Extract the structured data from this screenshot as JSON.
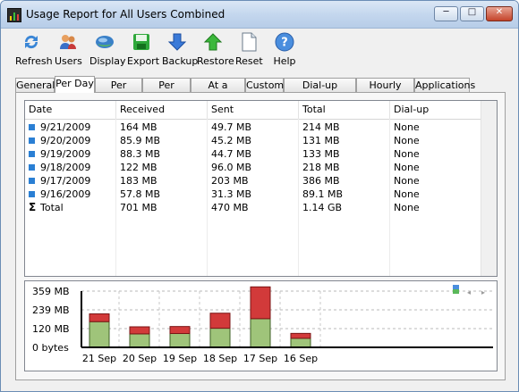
{
  "window": {
    "title": "Usage Report for All Users Combined",
    "controls": {
      "minimize": "─",
      "maximize": "□",
      "close": "✕"
    }
  },
  "toolbar": {
    "items": [
      {
        "label": "Refresh",
        "icon": "refresh-icon"
      },
      {
        "label": "Users",
        "icon": "users-icon"
      },
      {
        "label": "Display",
        "icon": "display-icon"
      },
      {
        "label": "Export",
        "icon": "export-icon"
      },
      {
        "label": "Backup",
        "icon": "backup-icon"
      },
      {
        "label": "Restore",
        "icon": "restore-icon"
      },
      {
        "label": "Reset",
        "icon": "reset-icon"
      },
      {
        "label": "Help",
        "icon": "help-icon"
      }
    ]
  },
  "tabs": [
    {
      "label": "General"
    },
    {
      "label": "Per Day",
      "active": true
    },
    {
      "label": "Per Week"
    },
    {
      "label": "Per Month"
    },
    {
      "label": "At a Glance"
    },
    {
      "label": "Custom"
    },
    {
      "label": "Dial-up Sessions"
    },
    {
      "label": "Hourly Rates"
    },
    {
      "label": "Applications"
    }
  ],
  "table": {
    "columns": [
      "Date",
      "Received",
      "Sent",
      "Total",
      "Dial-up"
    ],
    "rows": [
      [
        "9/21/2009",
        "164 MB",
        "49.7 MB",
        "214 MB",
        "None"
      ],
      [
        "9/20/2009",
        "85.9 MB",
        "45.2 MB",
        "131 MB",
        "None"
      ],
      [
        "9/19/2009",
        "88.3 MB",
        "44.7 MB",
        "133 MB",
        "None"
      ],
      [
        "9/18/2009",
        "122 MB",
        "96.0 MB",
        "218 MB",
        "None"
      ],
      [
        "9/17/2009",
        "183 MB",
        "203 MB",
        "386 MB",
        "None"
      ],
      [
        "9/16/2009",
        "57.8 MB",
        "31.3 MB",
        "89.1 MB",
        "None"
      ]
    ],
    "total": [
      "Total",
      "701 MB",
      "470 MB",
      "1.14 GB",
      "None"
    ]
  },
  "colors": {
    "received": "#9fc47a",
    "sent": "#d23a3a",
    "row_marker": "#2a7fd4"
  },
  "chart_data": {
    "type": "bar",
    "stacked": true,
    "categories": [
      "21 Sep",
      "20 Sep",
      "19 Sep",
      "18 Sep",
      "17 Sep",
      "16 Sep"
    ],
    "series": [
      {
        "name": "",
        "values": [
          164,
          85.9,
          88.3,
          122,
          183,
          57.8
        ]
      },
      {
        "name": "",
        "values": [
          49.7,
          45.2,
          44.7,
          96.0,
          203,
          31.3
        ]
      }
    ],
    "y_ticks": [
      "359 MB",
      "239 MB",
      "120 MB",
      "0 bytes"
    ],
    "y_tick_values": [
      359,
      239,
      120,
      0
    ],
    "ylim": [
      0,
      400
    ],
    "grid": true,
    "controls": [
      "◂",
      "▸"
    ]
  }
}
